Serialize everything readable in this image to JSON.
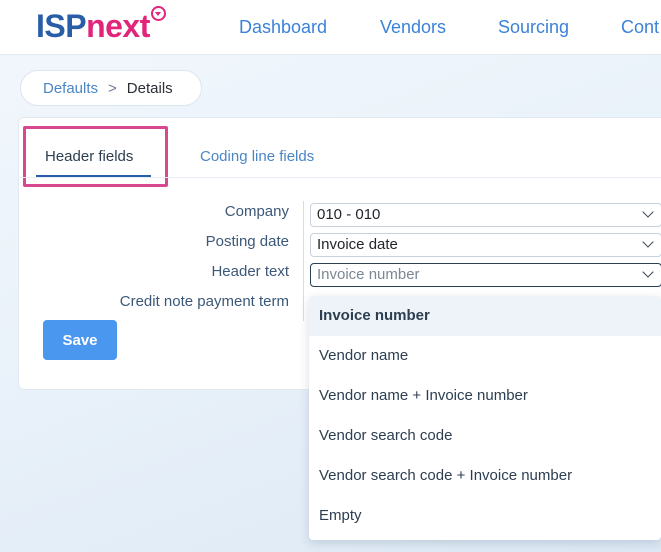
{
  "header": {
    "logo_part1": "ISP",
    "logo_part2": "next",
    "nav": [
      "Dashboard",
      "Vendors",
      "Sourcing",
      "Cont"
    ]
  },
  "breadcrumb": {
    "parent": "Defaults",
    "separator": ">",
    "current": "Details"
  },
  "tabs": {
    "header_fields": "Header fields",
    "coding_line_fields": "Coding line fields"
  },
  "form": {
    "company_label": "Company",
    "company_value": "010 - 010",
    "posting_date_label": "Posting date",
    "posting_date_value": "Invoice date",
    "header_text_label": "Header text",
    "header_text_value": "Invoice number",
    "credit_note_label": "Credit note payment term",
    "save_label": "Save"
  },
  "dropdown": {
    "options": [
      "Invoice number",
      "Vendor name",
      "Vendor name + Invoice number",
      "Vendor search code",
      "Vendor search code + Invoice number",
      "Empty"
    ],
    "selected": "Invoice number"
  },
  "colors": {
    "brand_blue": "#2a5da8",
    "brand_pink": "#e2247a",
    "highlight": "#d9478f",
    "save_button": "#4a97f0"
  }
}
